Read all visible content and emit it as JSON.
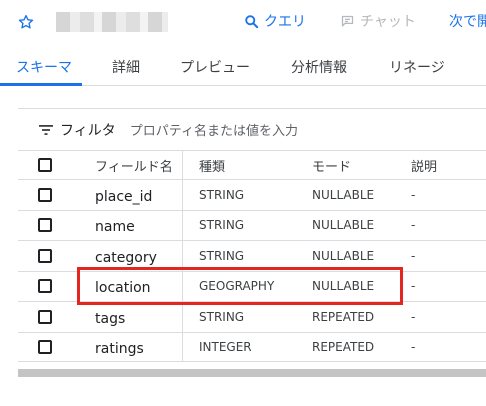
{
  "header": {
    "query_label": "クエリ",
    "share_label": "チャット",
    "next_label": "次で開く"
  },
  "tabs": [
    {
      "label": "スキーマ",
      "active": true
    },
    {
      "label": "詳細"
    },
    {
      "label": "プレビュー"
    },
    {
      "label": "分析情報"
    },
    {
      "label": "リネージ"
    }
  ],
  "filter": {
    "label": "フィルタ",
    "placeholder": "プロパティ名または値を入力"
  },
  "table": {
    "columns": {
      "name": "フィールド名",
      "type": "種類",
      "mode": "モード",
      "description": "説明"
    },
    "rows": [
      {
        "name": "place_id",
        "type": "STRING",
        "mode": "NULLABLE",
        "description": "-"
      },
      {
        "name": "name",
        "type": "STRING",
        "mode": "NULLABLE",
        "description": "-"
      },
      {
        "name": "category",
        "type": "STRING",
        "mode": "NULLABLE",
        "description": "-"
      },
      {
        "name": "location",
        "type": "GEOGRAPHY",
        "mode": "NULLABLE",
        "description": "-",
        "highlighted": true
      },
      {
        "name": "tags",
        "type": "STRING",
        "mode": "REPEATED",
        "description": "-"
      },
      {
        "name": "ratings",
        "type": "INTEGER",
        "mode": "REPEATED",
        "description": "-"
      }
    ]
  },
  "colors": {
    "accent": "#1a73e8",
    "highlight": "#e3261f",
    "disabled": "#b4b7bb"
  }
}
